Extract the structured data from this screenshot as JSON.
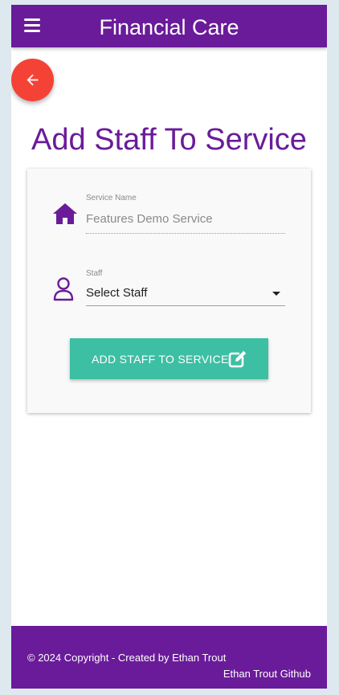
{
  "header": {
    "title": "Financial Care",
    "menu_icon": "hamburger-menu-icon",
    "background": "#6a1b9a"
  },
  "back_button": {
    "icon": "arrow-left-icon",
    "color": "#f44336"
  },
  "page": {
    "title": "Add Staff To Service",
    "title_color": "#6a1b9a"
  },
  "form": {
    "service_name": {
      "label": "Service Name",
      "value": "Features Demo Service",
      "icon": "home-icon"
    },
    "staff": {
      "label": "Staff",
      "selected": "Select Staff",
      "icon": "person-icon"
    },
    "submit": {
      "label": "ADD STAFF TO SERVICE",
      "icon": "edit-icon",
      "color": "#3dbfa4"
    }
  },
  "footer": {
    "copyright": "© 2024 Copyright - Created by Ethan Trout",
    "github_link": "Ethan Trout Github",
    "background": "#6a1b9a"
  }
}
